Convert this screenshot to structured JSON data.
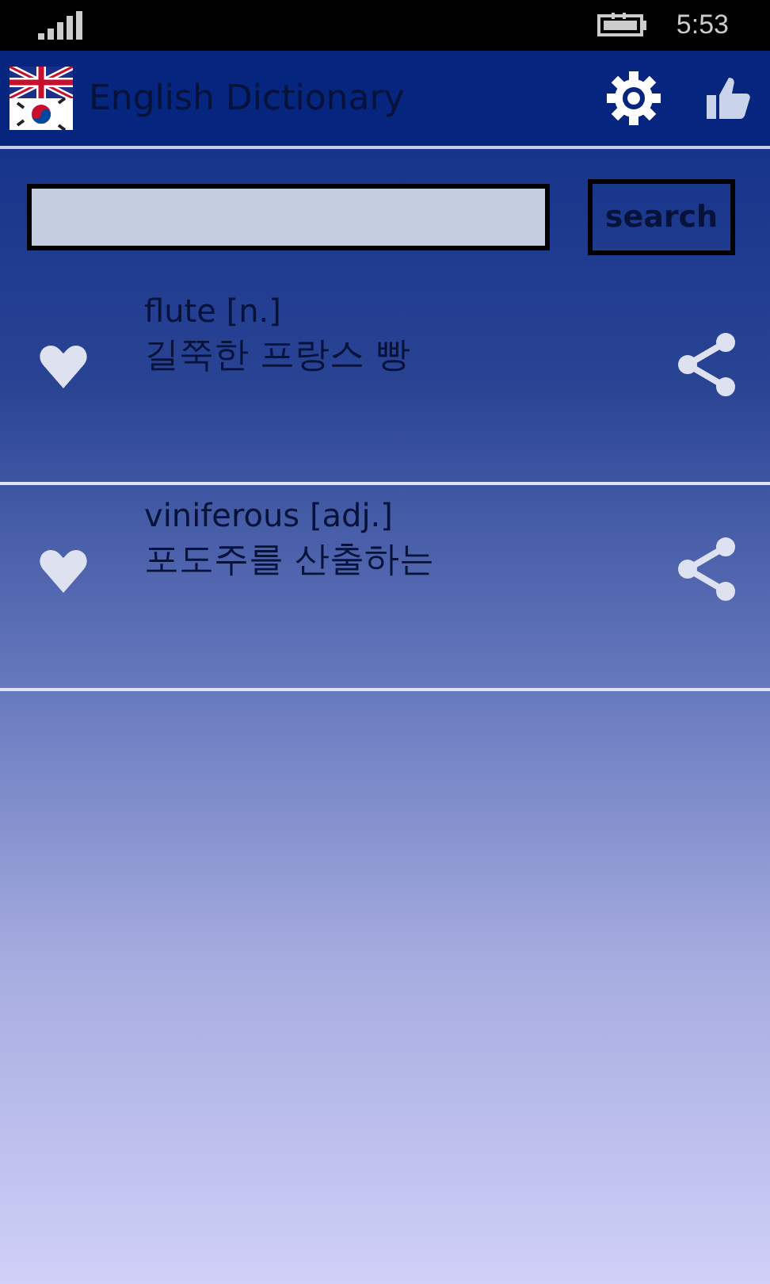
{
  "status_bar": {
    "time": "5:53"
  },
  "app_bar": {
    "title": "English Dictionary"
  },
  "search": {
    "button": "search"
  },
  "entries": [
    {
      "word": "flute [n.]",
      "meaning": "길쭉한 프랑스 빵"
    },
    {
      "word": "viniferous [adj.]",
      "meaning": "포도주를 산출하는"
    }
  ]
}
